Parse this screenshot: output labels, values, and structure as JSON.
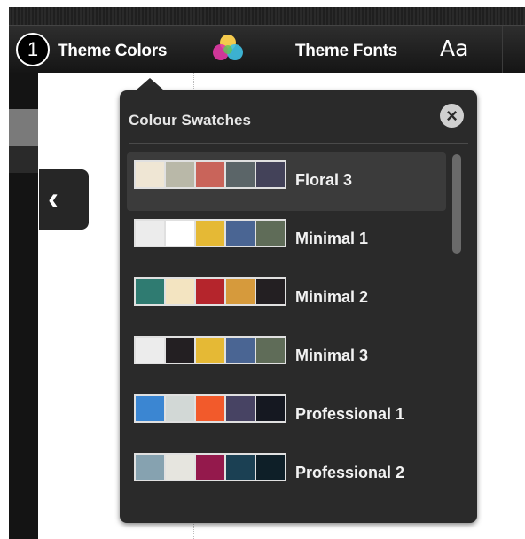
{
  "toolbar": {
    "step_number": "1",
    "theme_colors_label": "Theme Colors",
    "theme_fonts_label": "Theme Fonts",
    "fonts_icon_text": "Aa"
  },
  "popup": {
    "title": "Colour Swatches",
    "close_icon": "×",
    "selected_index": 0,
    "swatches": [
      {
        "name": "Floral 3",
        "colors": [
          "#efe6d4",
          "#b9b8a8",
          "#c9645a",
          "#5b6568",
          "#434259"
        ]
      },
      {
        "name": "Minimal 1",
        "colors": [
          "#ececec",
          "#ffffff",
          "#e5b935",
          "#4a6593",
          "#5f6c58"
        ]
      },
      {
        "name": "Minimal 2",
        "colors": [
          "#2f7b71",
          "#f3e4c1",
          "#b5252c",
          "#d69a3c",
          "#231f22"
        ]
      },
      {
        "name": "Minimal 3",
        "colors": [
          "#ececec",
          "#231f22",
          "#e5b935",
          "#4a6593",
          "#5f6c58"
        ]
      },
      {
        "name": "Professional 1",
        "colors": [
          "#3b86d2",
          "#d2d8d6",
          "#f25a2b",
          "#474363",
          "#151821"
        ]
      },
      {
        "name": "Professional 2",
        "colors": [
          "#86a2b0",
          "#e6e5df",
          "#94194c",
          "#1b4053",
          "#0e1f28"
        ]
      }
    ]
  },
  "sidebar": {
    "collapse_icon": "‹"
  }
}
